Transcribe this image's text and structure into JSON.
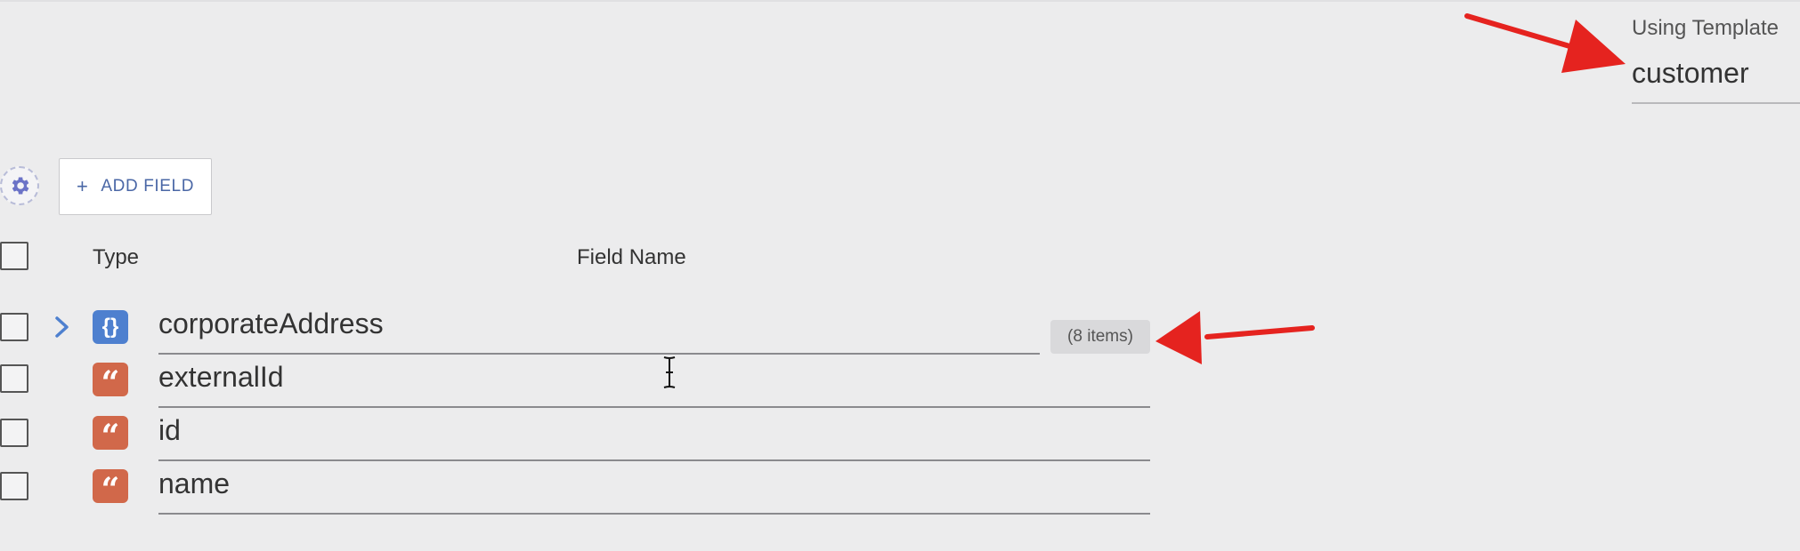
{
  "template": {
    "label": "Using Template",
    "value": "customer"
  },
  "toolbar": {
    "add_field_label": "ADD FIELD",
    "add_field_icon": "plus-icon",
    "settings_icon": "gear-icon"
  },
  "table": {
    "columns": [
      "Type",
      "Field Name"
    ],
    "rows": [
      {
        "type": "object",
        "type_icon": "curly-braces-icon",
        "name": "corporateAddress",
        "expandable": true,
        "items_badge": "(8 items)"
      },
      {
        "type": "string",
        "type_icon": "quote-icon",
        "name": "externalId"
      },
      {
        "type": "string",
        "type_icon": "quote-icon",
        "name": "id"
      },
      {
        "type": "string",
        "type_icon": "quote-icon",
        "name": "name"
      }
    ]
  },
  "colors": {
    "background": "#ececed",
    "object_badge": "#4e80cf",
    "string_badge": "#d1684a",
    "accent_text": "#4a67a6",
    "annotation_arrow": "#e5231f"
  }
}
